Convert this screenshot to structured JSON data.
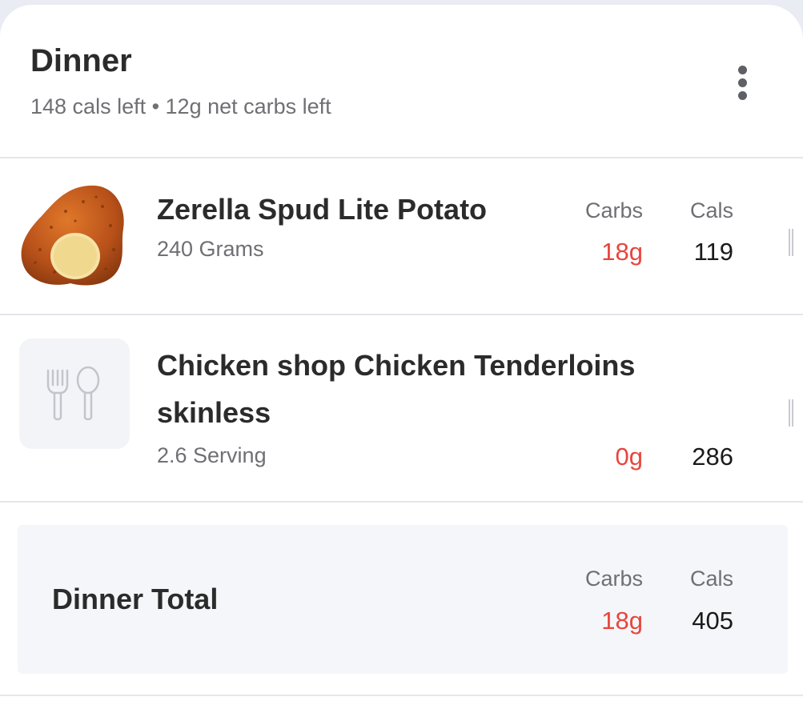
{
  "meal": {
    "title": "Dinner",
    "subtitle": "148 cals left • 12g net carbs left",
    "more_icon": "more-vertical-icon"
  },
  "columns": {
    "carbs": "Carbs",
    "cals": "Cals"
  },
  "foods": [
    {
      "name": "Zerella Spud Lite Potato",
      "serving": "240 Grams",
      "carbs": "18g",
      "cals": "119",
      "icon": "potato-icon"
    },
    {
      "name_line1": "Chicken shop Chicken Tenderloins",
      "name_line2": "skinless",
      "serving": "2.6 Serving",
      "carbs": "0g",
      "cals": "286",
      "icon": "utensils-icon"
    }
  ],
  "total": {
    "label": "Dinner Total",
    "carbs": "18g",
    "cals": "405"
  },
  "colors": {
    "carbs": "#e8453c",
    "text_primary": "#2b2b2b",
    "text_secondary": "#6f6f74",
    "total_bg": "#f5f6f9"
  }
}
